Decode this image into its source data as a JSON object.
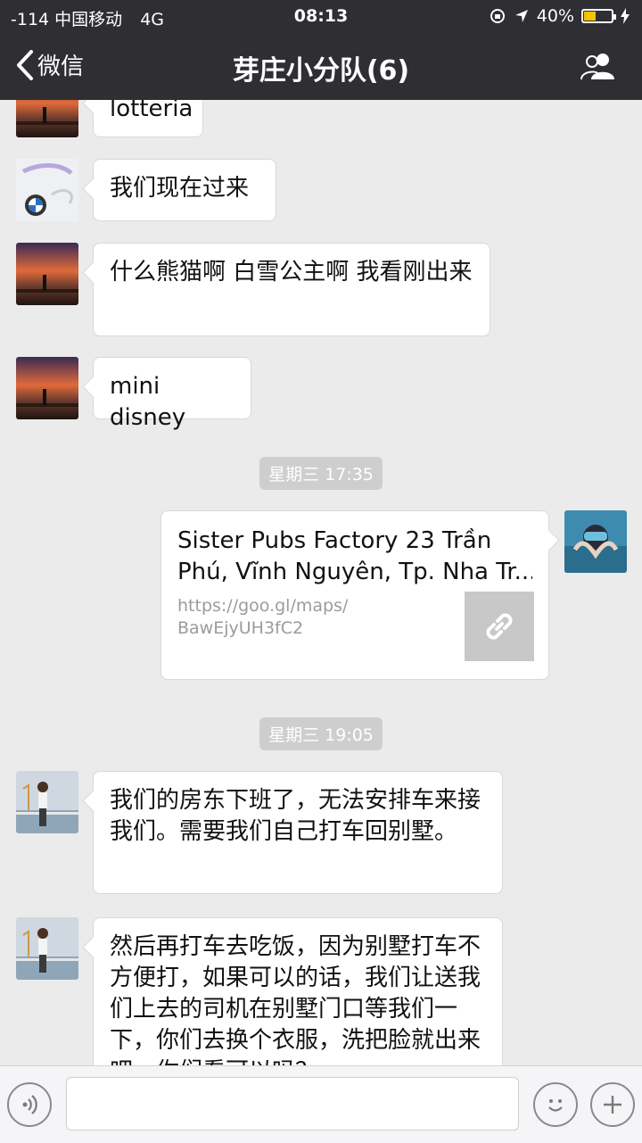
{
  "status_bar": {
    "signal": "-114 中国移动",
    "network": "4G",
    "time": "08:13",
    "battery": "40%",
    "battery_level": 0.4
  },
  "nav": {
    "back_label": "微信",
    "title": "芽庄小分队(6)"
  },
  "messages": [
    {
      "text": "lotteria"
    },
    {
      "text": "我们现在过来"
    },
    {
      "text": "什么熊猫啊 白雪公主啊 我看刚出来"
    },
    {
      "text": "mini disney"
    },
    {
      "timestamp": "星期三 17:35"
    },
    {
      "link_title": "Sister Pubs Factory 23 Trần Phú, Vĩnh Nguyên, Tp. Nha Tr...",
      "link_title_line1": "Sister Pubs Factory 23 Trần",
      "link_title_line2": "Phú, Vĩnh Nguyên, Tp. Nha Tr...",
      "link_url_line1": "https://goo.gl/maps/",
      "link_url_line2": "BawEjyUH3fC2"
    },
    {
      "timestamp": "星期三 19:05"
    },
    {
      "text": "我们的房东下班了，无法安排车来接我们。需要我们自己打车回别墅。"
    },
    {
      "text": "然后再打车去吃饭，因为别墅打车不方便打，如果可以的话，我们让送我们上去的司机在别墅门口等我们一下，你们去换个衣服，洗把脸就出来吧，你们看可以吗？"
    }
  ],
  "colors": {
    "nav_bg": "#2e2e33",
    "chat_bg": "#ebebeb",
    "bubble_bg": "#ffffff",
    "timestamp_bg": "#cecece"
  }
}
